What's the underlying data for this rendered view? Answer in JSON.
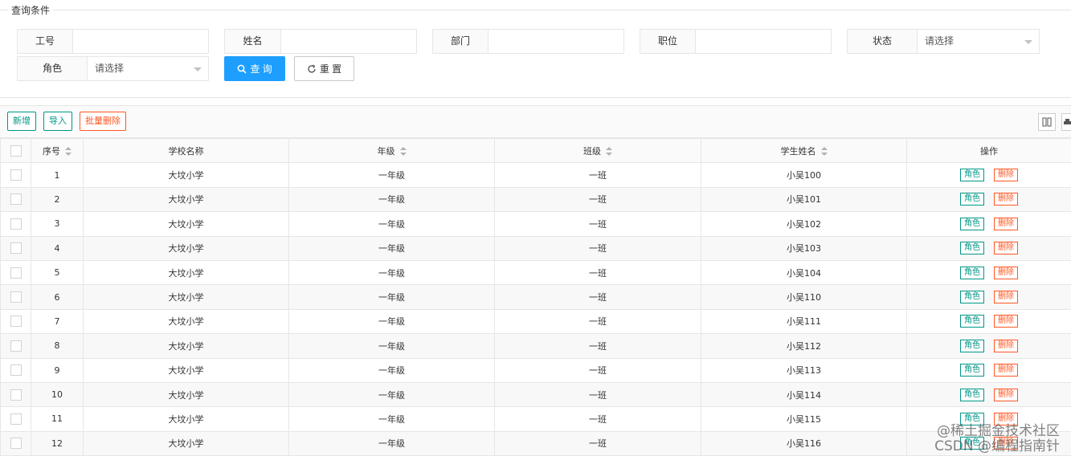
{
  "query": {
    "legend": "查询条件",
    "fields": [
      {
        "label": "工号",
        "type": "input",
        "value": ""
      },
      {
        "label": "姓名",
        "type": "input",
        "value": ""
      },
      {
        "label": "部门",
        "type": "input",
        "value": ""
      },
      {
        "label": "职位",
        "type": "input",
        "value": ""
      },
      {
        "label": "状态",
        "type": "select",
        "value": "请选择"
      },
      {
        "label": "角色",
        "type": "select",
        "value": "请选择"
      }
    ],
    "search_label": "查 询",
    "reset_label": "重 置"
  },
  "toolbar": {
    "add_label": "新增",
    "import_label": "导入",
    "batch_delete_label": "批量删除",
    "icons": [
      "columns-icon",
      "print-icon"
    ]
  },
  "table": {
    "columns": [
      "序号",
      "学校名称",
      "年级",
      "班级",
      "学生姓名",
      "操作"
    ],
    "sortable": [
      true,
      false,
      true,
      true,
      true,
      false
    ],
    "rows": [
      {
        "no": "1",
        "school": "大坟小学",
        "grade": "一年级",
        "class": "一班",
        "student": "小吴100"
      },
      {
        "no": "2",
        "school": "大坟小学",
        "grade": "一年级",
        "class": "一班",
        "student": "小吴101"
      },
      {
        "no": "3",
        "school": "大坟小学",
        "grade": "一年级",
        "class": "一班",
        "student": "小吴102"
      },
      {
        "no": "4",
        "school": "大坟小学",
        "grade": "一年级",
        "class": "一班",
        "student": "小吴103"
      },
      {
        "no": "5",
        "school": "大坟小学",
        "grade": "一年级",
        "class": "一班",
        "student": "小吴104"
      },
      {
        "no": "6",
        "school": "大坟小学",
        "grade": "一年级",
        "class": "一班",
        "student": "小吴110"
      },
      {
        "no": "7",
        "school": "大坟小学",
        "grade": "一年级",
        "class": "一班",
        "student": "小吴111"
      },
      {
        "no": "8",
        "school": "大坟小学",
        "grade": "一年级",
        "class": "一班",
        "student": "小吴112"
      },
      {
        "no": "9",
        "school": "大坟小学",
        "grade": "一年级",
        "class": "一班",
        "student": "小吴113"
      },
      {
        "no": "10",
        "school": "大坟小学",
        "grade": "一年级",
        "class": "一班",
        "student": "小吴114"
      },
      {
        "no": "11",
        "school": "大坟小学",
        "grade": "一年级",
        "class": "一班",
        "student": "小吴115"
      },
      {
        "no": "12",
        "school": "大坟小学",
        "grade": "一年级",
        "class": "一班",
        "student": "小吴116"
      }
    ],
    "action_role_label": "角色",
    "action_delete_label": "删除"
  },
  "watermark": {
    "line1": "@稀土掘金技术社区",
    "line2": "CSDN @编程指南针"
  },
  "colors": {
    "primary": "#1e9fff",
    "green": "#009688",
    "red": "#ff5722"
  }
}
